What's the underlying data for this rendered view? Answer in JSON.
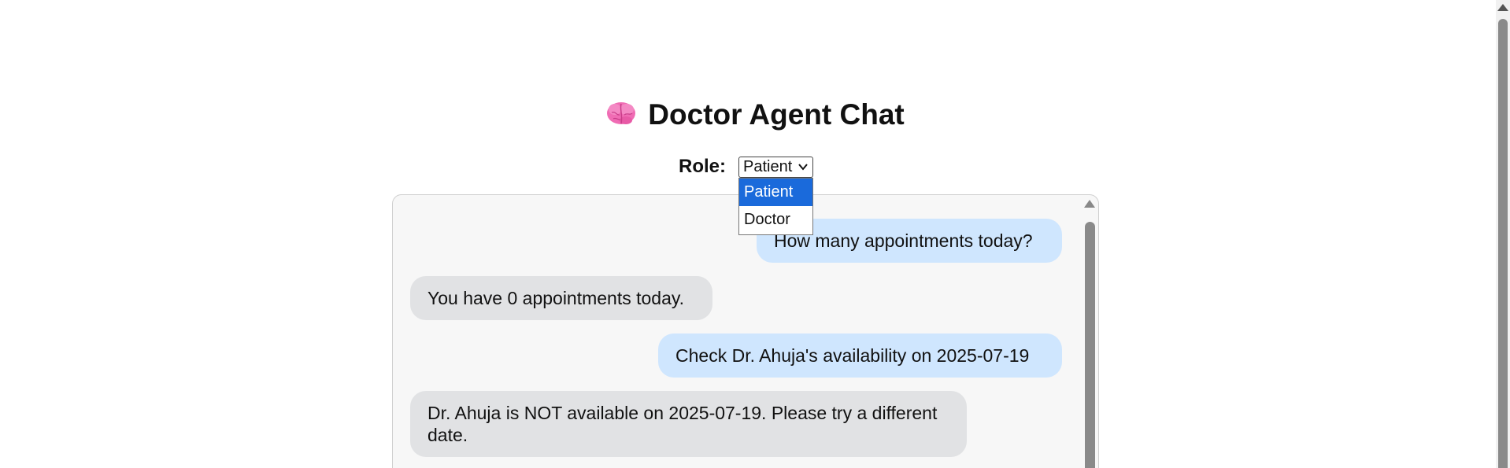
{
  "header": {
    "icon": "brain-icon",
    "title": "Doctor Agent Chat"
  },
  "role": {
    "label": "Role:",
    "selected": "Patient",
    "options": [
      "Patient",
      "Doctor"
    ]
  },
  "chat": {
    "messages": [
      {
        "sender": "user",
        "text": "How many appointments today?"
      },
      {
        "sender": "bot",
        "text": "You have 0 appointments today."
      },
      {
        "sender": "user",
        "text": "Check Dr. Ahuja's availability on 2025-07-19"
      },
      {
        "sender": "bot",
        "text": "Dr. Ahuja is NOT available on 2025-07-19. Please try a different date."
      }
    ]
  },
  "colors": {
    "user_bubble": "#cfe6fe",
    "bot_bubble": "#e1e2e4",
    "dropdown_highlight": "#1a6adb"
  }
}
